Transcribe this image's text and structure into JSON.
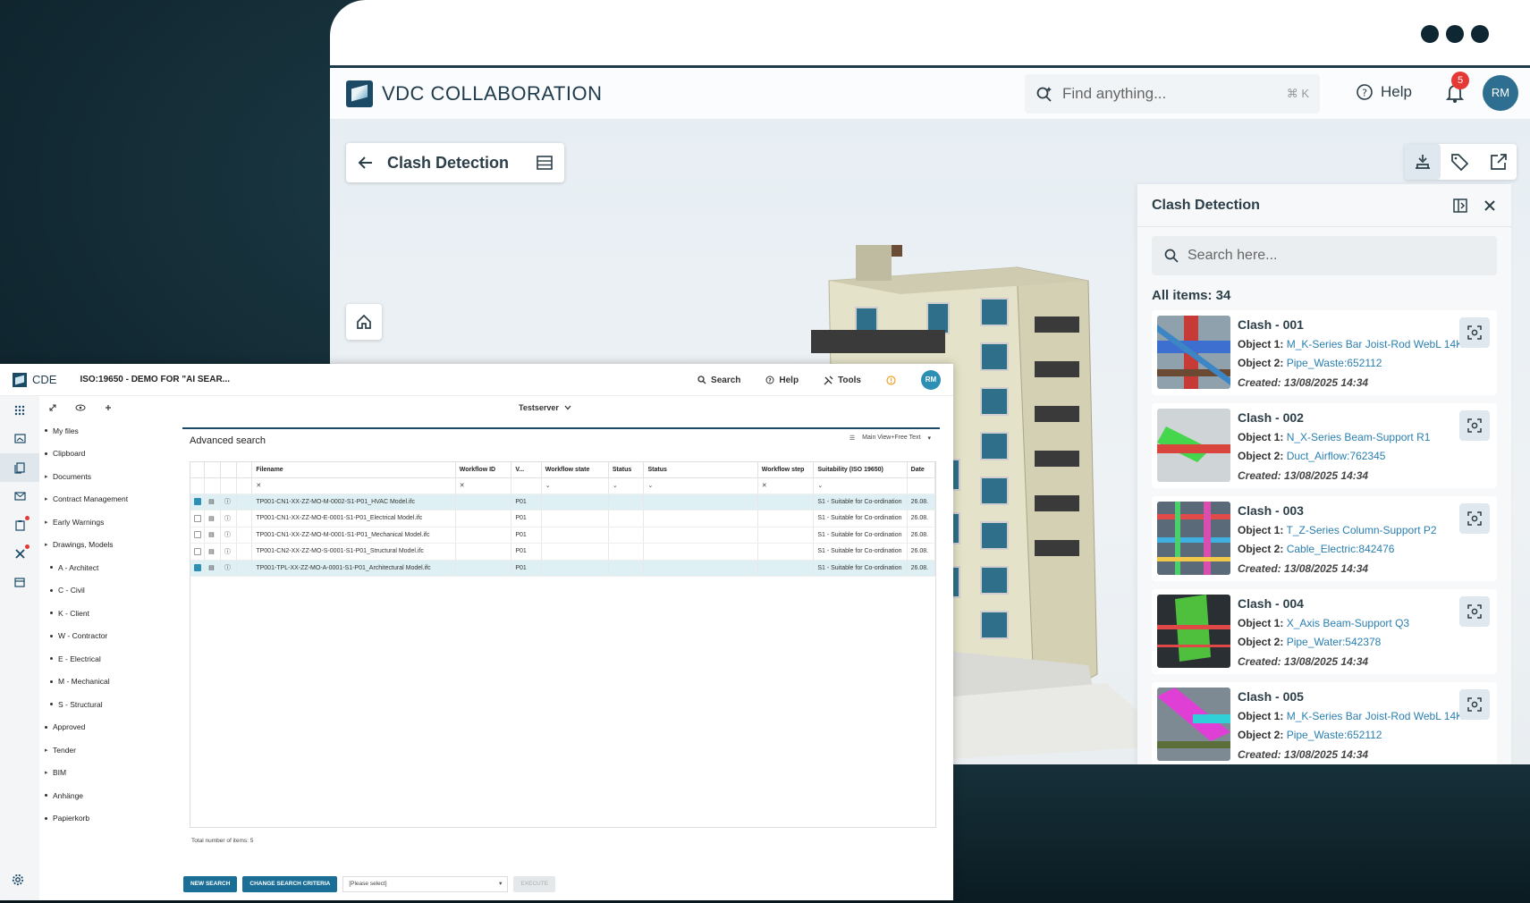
{
  "vdc": {
    "brand": "VDC COLLABORATION",
    "search_placeholder": "Find anything...",
    "search_shortcut": "⌘ K",
    "help_label": "Help",
    "notification_count": "5",
    "avatar_initials": "RM",
    "clash_pill_title": "Clash Detection",
    "panel": {
      "title": "Clash Detection",
      "search_placeholder": "Search here...",
      "count_label": "All items: 34",
      "items": [
        {
          "title": "Clash - 001",
          "obj1_label": "Object 1:",
          "obj1": "M_K-Series Bar Joist-Rod WebL 14K",
          "obj2_label": "Object 2:",
          "obj2": "Pipe_Waste:652112",
          "created": "Created: 13/08/2025 14:34"
        },
        {
          "title": "Clash - 002",
          "obj1_label": "Object 1:",
          "obj1": "N_X-Series Beam-Support R1",
          "obj2_label": "Object 2:",
          "obj2": "Duct_Airflow:762345",
          "created": "Created: 13/08/2025 14:34"
        },
        {
          "title": "Clash - 003",
          "obj1_label": "Object 1:",
          "obj1": "T_Z-Series Column-Support P2",
          "obj2_label": "Object 2:",
          "obj2": "Cable_Electric:842476",
          "created": "Created: 13/08/2025 14:34"
        },
        {
          "title": "Clash - 004",
          "obj1_label": "Object 1:",
          "obj1": "X_Axis Beam-Support Q3",
          "obj2_label": "Object 2:",
          "obj2": "Pipe_Water:542378",
          "created": "Created: 13/08/2025 14:34"
        },
        {
          "title": "Clash - 005",
          "obj1_label": "Object 1:",
          "obj1": "M_K-Series Bar Joist-Rod WebL 14K",
          "obj2_label": "Object 2:",
          "obj2": "Pipe_Waste:652112",
          "created": "Created: 13/08/2025 14:34"
        }
      ]
    }
  },
  "cde": {
    "brand": "CDE",
    "project": "ISO:19650 - DEMO FOR \"AI SEAR...",
    "search_label": "Search",
    "help_label": "Help",
    "tools_label": "Tools",
    "avatar_initials": "RM",
    "server": "Testserver",
    "tree": [
      {
        "label": "My files",
        "sub": false,
        "caret": false
      },
      {
        "label": "Clipboard",
        "sub": false,
        "caret": false
      },
      {
        "label": "Documents",
        "sub": false,
        "caret": true
      },
      {
        "label": "Contract Management",
        "sub": false,
        "caret": true
      },
      {
        "label": "Early Warnings",
        "sub": false,
        "caret": true
      },
      {
        "label": "Drawings, Models",
        "sub": false,
        "caret": true
      },
      {
        "label": "A - Architect",
        "sub": true,
        "caret": false
      },
      {
        "label": "C - Civil",
        "sub": true,
        "caret": false
      },
      {
        "label": "K - Client",
        "sub": true,
        "caret": false
      },
      {
        "label": "W - Contractor",
        "sub": true,
        "caret": false
      },
      {
        "label": "E - Electrical",
        "sub": true,
        "caret": false
      },
      {
        "label": "M - Mechanical",
        "sub": true,
        "caret": false
      },
      {
        "label": "S - Structural",
        "sub": true,
        "caret": false
      },
      {
        "label": "Approved",
        "sub": false,
        "caret": false
      },
      {
        "label": "Tender",
        "sub": false,
        "caret": true
      },
      {
        "label": "BIM",
        "sub": false,
        "caret": true
      },
      {
        "label": "Anhänge",
        "sub": false,
        "caret": false
      },
      {
        "label": "Papierkorb",
        "sub": false,
        "caret": false
      }
    ],
    "advanced_search_title": "Advanced search",
    "view_label": "Main View+Free Text",
    "columns": [
      "Filename",
      "Workflow ID",
      "V...",
      "Workflow state",
      "Status",
      "Status",
      "Workflow step",
      "Suitability (ISO 19650)",
      "Date"
    ],
    "rows": [
      {
        "checked": true,
        "filename": "TP001-CN1-XX-ZZ-MO-M-0002-S1-P01_HVAC Model.ifc",
        "version": "P01",
        "suitability": "S1 - Suitable for Co-ordination",
        "date": "26.08."
      },
      {
        "checked": false,
        "filename": "TP001-CN1-XX-ZZ-MO-E-0001-S1-P01_Electrical Model.ifc",
        "version": "P01",
        "suitability": "S1 - Suitable for Co-ordination",
        "date": "26.08."
      },
      {
        "checked": false,
        "filename": "TP001-CN1-XX-ZZ-MO-M-0001-S1-P01_Mechanical Model.ifc",
        "version": "P01",
        "suitability": "S1 - Suitable for Co-ordination",
        "date": "26.08."
      },
      {
        "checked": false,
        "filename": "TP001-CN2-XX-ZZ-MO-S-0001-S1-P01_Structural Model.ifc",
        "version": "P01",
        "suitability": "S1 - Suitable for Co-ordination",
        "date": "26.08."
      },
      {
        "checked": true,
        "filename": "TP001-TPL-XX-ZZ-MO-A-0001-S1-P01_Architectural Model.ifc",
        "version": "P01",
        "suitability": "S1 - Suitable for Co-ordination",
        "date": "26.08."
      }
    ],
    "total_label": "Total number of items: 5",
    "new_search": "NEW SEARCH",
    "change_criteria": "CHANGE SEARCH CRITERIA",
    "select_placeholder": "[Please select]",
    "execute": "EXECUTE"
  }
}
